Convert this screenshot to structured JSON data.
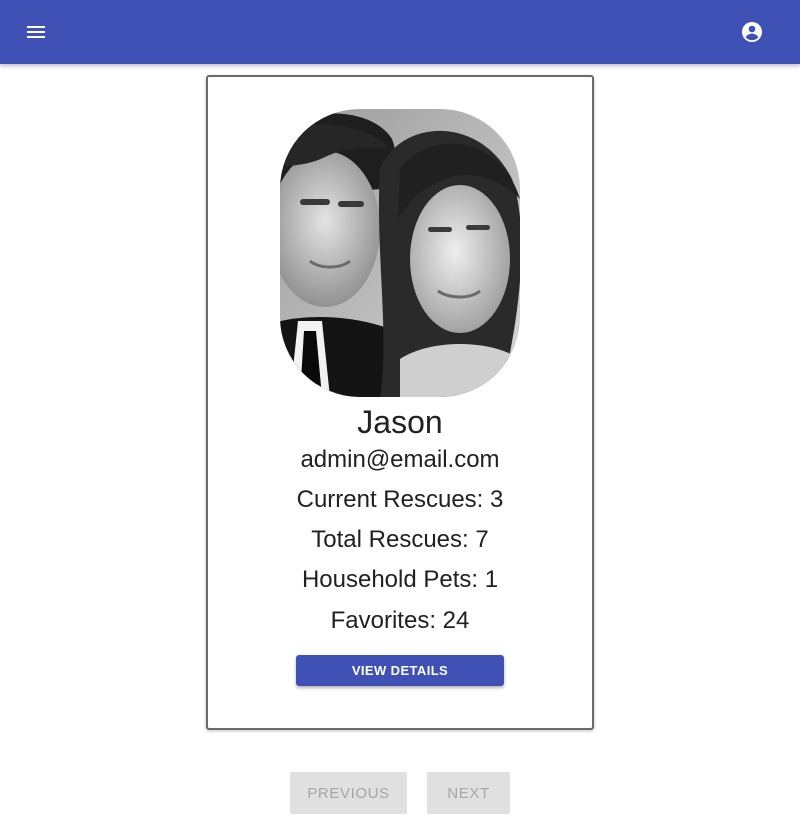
{
  "header": {
    "menu_icon": "menu-icon",
    "account_icon": "account-circle-icon",
    "brand_color": "#3f51b5"
  },
  "profile": {
    "photo_description_icon": "profile-photo",
    "name": "Jason",
    "email": "admin@email.com",
    "stats": [
      {
        "label": "Current Rescues: 3"
      },
      {
        "label": "Total Rescues: 7"
      },
      {
        "label": "Household Pets: 1"
      },
      {
        "label": "Favorites: 24"
      }
    ],
    "view_details_label": "VIEW DETAILS"
  },
  "pagination": {
    "previous_label": "PREVIOUS",
    "next_label": "NEXT",
    "disabled_color": "#e0e0e0"
  }
}
